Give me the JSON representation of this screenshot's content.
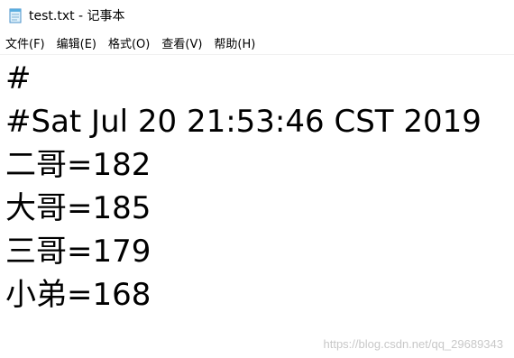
{
  "window": {
    "title": "test.txt - 记事本",
    "icon": "notepad-icon"
  },
  "menubar": {
    "items": [
      {
        "label": "文件(F)"
      },
      {
        "label": "编辑(E)"
      },
      {
        "label": "格式(O)"
      },
      {
        "label": "查看(V)"
      },
      {
        "label": "帮助(H)"
      }
    ]
  },
  "editor": {
    "lines": [
      "#",
      "#Sat Jul 20 21:53:46 CST 2019",
      "二哥=182",
      "大哥=185",
      "三哥=179",
      "小弟=168"
    ]
  },
  "watermark": "https://blog.csdn.net/qq_29689343"
}
